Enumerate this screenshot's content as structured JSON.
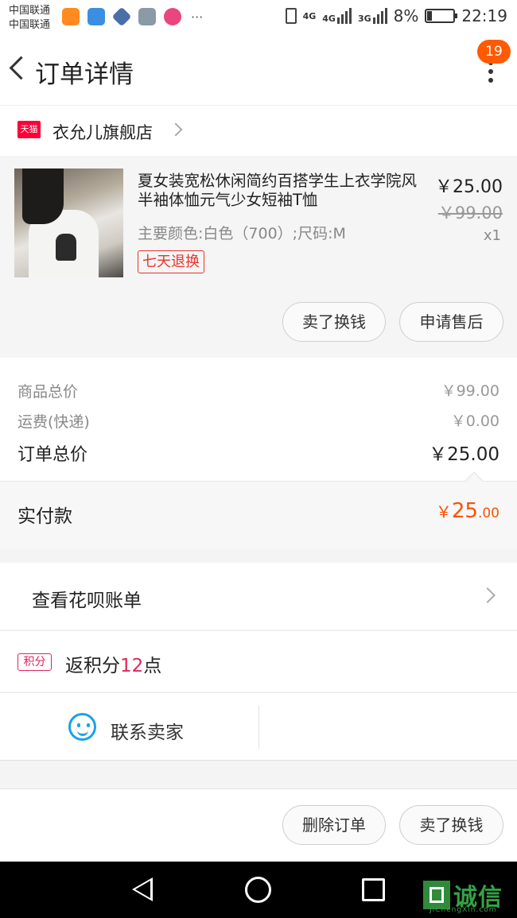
{
  "status_bar": {
    "carrier_1": "中国联通",
    "carrier_2": "中国联通",
    "more": "···",
    "network_1": "4G",
    "network_2": "4G",
    "network_3": "3G",
    "battery": "8%",
    "time": "22:19"
  },
  "header": {
    "title": "订单详情",
    "badge_count": "19"
  },
  "shop": {
    "platform_badge": "天猫",
    "name": "衣允儿旗舰店"
  },
  "product": {
    "title": "夏女装宽松休闲简约百搭学生上衣学院风半袖体恤元气少女短袖T恤",
    "price": "￥25.00",
    "original_price": "￥99.00",
    "quantity": "x1",
    "spec": "主要颜色:白色（700）;尺码:M",
    "return_tag": "七天退换",
    "btn_resell": "卖了换钱",
    "btn_after_sale": "申请售后"
  },
  "summary": {
    "goods_total_label": "商品总价",
    "goods_total_value": "￥99.00",
    "shipping_label": "运费(快递)",
    "shipping_value": "￥0.00",
    "order_total_label": "订单总价",
    "order_total_value": "￥25.00",
    "paid_label": "实付款",
    "paid_currency": "￥",
    "paid_integer": "25",
    "paid_decimal": ".00"
  },
  "huabei": {
    "label": "查看花呗账单"
  },
  "points": {
    "tag": "积分",
    "prefix": "返积分",
    "amount": "12",
    "suffix": "点"
  },
  "contact": {
    "label": "联系卖家"
  },
  "actions": {
    "delete_order": "删除订单",
    "resell": "卖了换钱"
  },
  "watermark": {
    "text": "诚信",
    "sub": "JiChengXin.com"
  },
  "colors": {
    "accent_orange": "#ff5000",
    "tmall_red": "#ff0036",
    "points_pink": "#e0245e",
    "contact_blue": "#1aa1e8"
  },
  "icons": [
    "back-icon",
    "more-icon",
    "tmall-icon",
    "chevron-right-icon",
    "points-icon",
    "contact-seller-icon",
    "nav-back-icon",
    "nav-home-icon",
    "nav-recent-icon"
  ]
}
